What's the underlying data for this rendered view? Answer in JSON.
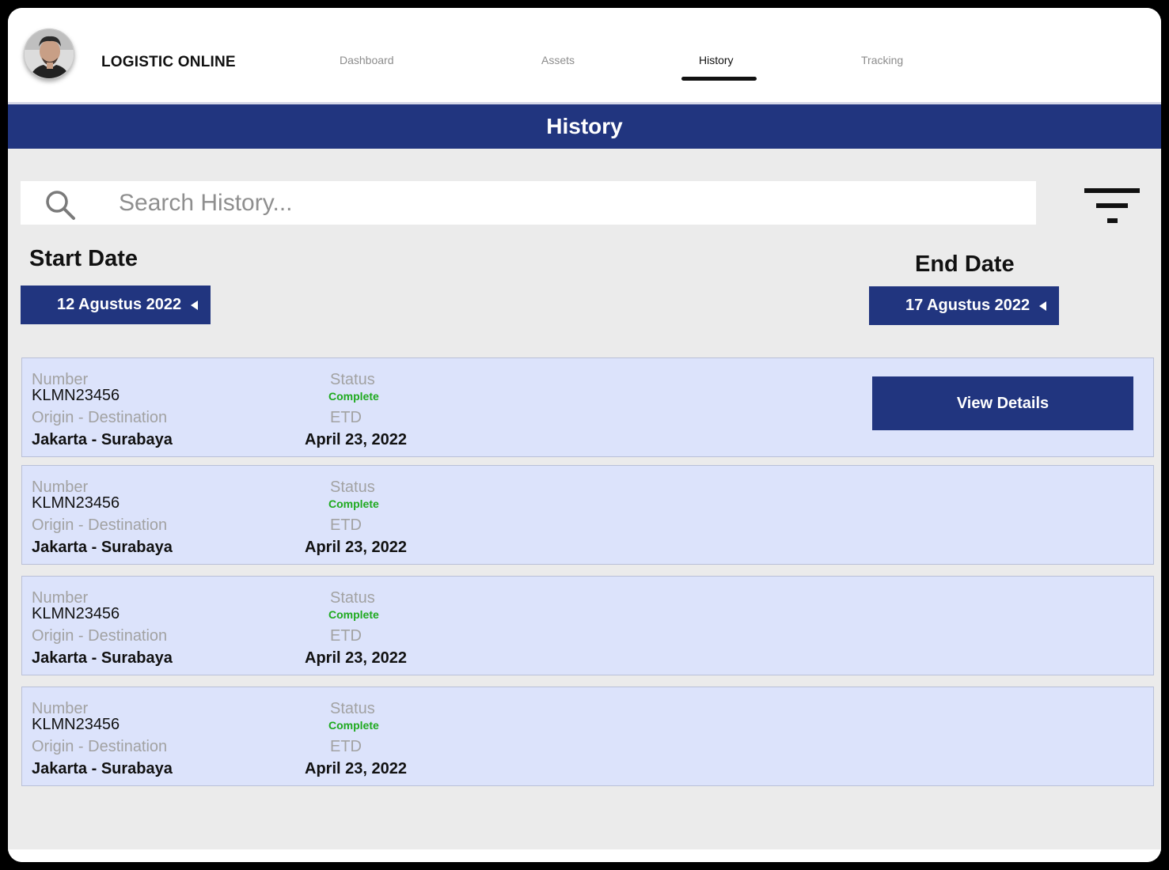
{
  "app": {
    "brand": "LOGISTIC ONLINE"
  },
  "nav": {
    "items": [
      {
        "label": "Dashboard",
        "active": false
      },
      {
        "label": "Assets",
        "active": false
      },
      {
        "label": "History",
        "active": true
      },
      {
        "label": "Tracking",
        "active": false
      }
    ]
  },
  "page": {
    "title": "History"
  },
  "search": {
    "placeholder": "Search History...",
    "value": ""
  },
  "filters": {
    "start_label": "Start Date",
    "start_value": "12 Agustus 2022",
    "end_label": "End Date",
    "end_value": "17 Agustus 2022"
  },
  "records": [
    {
      "number_label": "Number",
      "number": "KLMN23456",
      "status_label": "Status",
      "status": "Complete",
      "route_label": "Origin - Destination",
      "route": "Jakarta - Surabaya",
      "etd_label": "ETD",
      "etd": "April 23, 2022",
      "action": "View Details"
    },
    {
      "number_label": "Number",
      "number": "KLMN23456",
      "status_label": "Status",
      "status": "Complete",
      "route_label": "Origin - Destination",
      "route": "Jakarta - Surabaya",
      "etd_label": "ETD",
      "etd": "April 23, 2022"
    },
    {
      "number_label": "Number",
      "number": "KLMN23456",
      "status_label": "Status",
      "status": "Complete",
      "route_label": "Origin - Destination",
      "route": "Jakarta - Surabaya",
      "etd_label": "ETD",
      "etd": "April 23, 2022"
    },
    {
      "number_label": "Number",
      "number": "KLMN23456",
      "status_label": "Status",
      "status": "Complete",
      "route_label": "Origin - Destination",
      "route": "Jakarta - Surabaya",
      "etd_label": "ETD",
      "etd": "April 23, 2022"
    }
  ],
  "colors": {
    "primary": "#21357f",
    "card": "#dce3fb",
    "status_complete": "#1faa1f",
    "background": "#ebebeb"
  },
  "icons": {
    "search": "search-icon",
    "filter": "filter-icon",
    "dropdown": "caret-left-icon",
    "avatar": "user-avatar"
  }
}
